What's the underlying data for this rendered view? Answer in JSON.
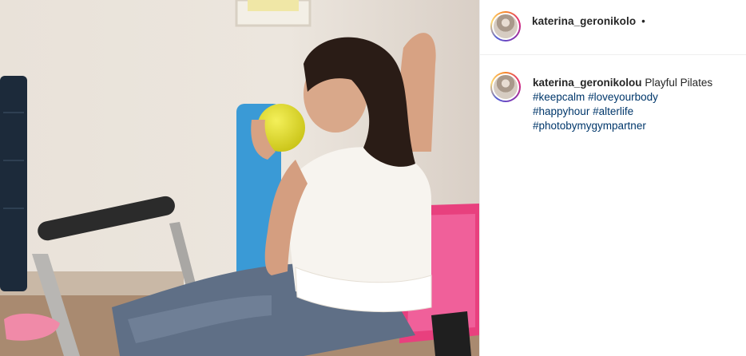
{
  "post": {
    "header_username": "katerina_geronikolo",
    "header_separator": "•",
    "caption": {
      "username": "katerina_geronikolou",
      "text": "Playful Pilates",
      "hashtags": [
        "#keepcalm",
        "#loveyourbody",
        "#happyhour",
        "#alterlife",
        "#photobymygympartner"
      ]
    }
  },
  "colors": {
    "username": "#262626",
    "hashtag": "#00376b",
    "divider": "#efefef"
  },
  "icons": {
    "avatar": "profile-picture"
  }
}
